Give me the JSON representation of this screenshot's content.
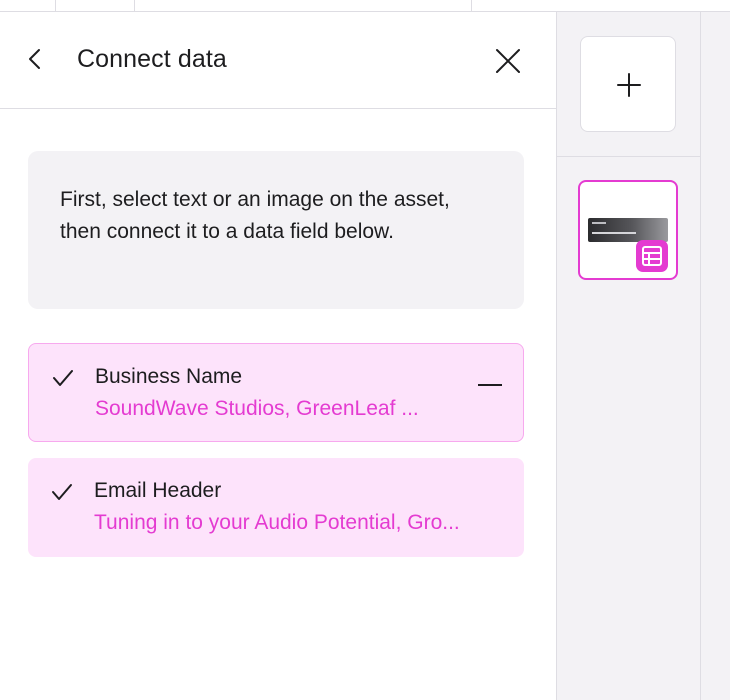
{
  "panel": {
    "title": "Connect data",
    "back_icon": "chevron-left-icon",
    "close_icon": "close-icon"
  },
  "info": {
    "text": "First, select text or an image on the asset, then connect it to a data field below."
  },
  "fields": [
    {
      "name": "Business Name",
      "values": "SoundWave Studios, GreenLeaf ...",
      "connected": true,
      "selected": true
    },
    {
      "name": "Email Header",
      "values": "Tuning in to your Audio Potential, Gro...",
      "connected": true,
      "selected": false
    }
  ],
  "rail": {
    "add_icon": "plus-icon",
    "thumbnail_badge_icon": "table-icon"
  },
  "colors": {
    "accent": "#e43bd1",
    "card_bg": "#fde3fb",
    "card_border": "#f7a9ee",
    "info_bg": "#f3f2f5",
    "rail_bg": "#f3f2f5"
  }
}
